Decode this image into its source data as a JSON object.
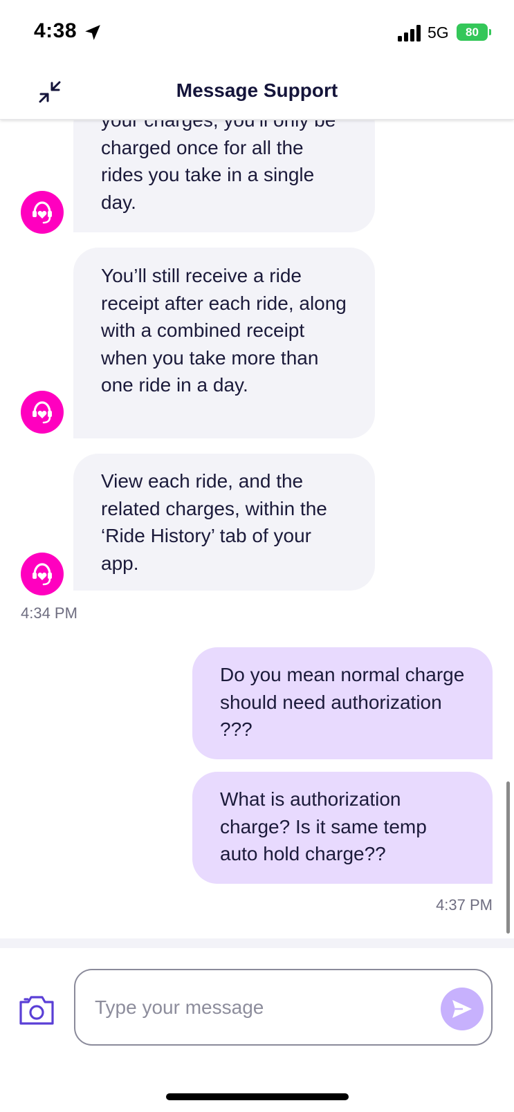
{
  "status_bar": {
    "time": "4:38",
    "network": "5G",
    "battery": "80"
  },
  "header": {
    "title": "Message Support"
  },
  "messages": [
    {
      "sender": "support",
      "text": "your charges, you’ll only be charged once for all the rides you take in a single day."
    },
    {
      "sender": "support",
      "text": "You’ll still receive a ride receipt after each ride, along with a combined receipt when you take more than one ride in a day."
    },
    {
      "sender": "support",
      "text": "View each ride, and the related charges, within the ‘Ride History’ tab of your app."
    },
    {
      "sender": "user",
      "text": "Do you mean normal charge should need authorization ???"
    },
    {
      "sender": "user",
      "text": "What is authorization charge? Is it same temp auto hold charge??"
    }
  ],
  "timestamps": {
    "support": "4:34 PM",
    "user": "4:37 PM"
  },
  "composer": {
    "placeholder": "Type your message",
    "value": ""
  },
  "icons": {
    "minimize": "minimize-arrows-icon",
    "avatar": "support-agent-heart-icon",
    "camera": "camera-icon",
    "send": "send-arrow-icon",
    "location": "location-arrow-icon",
    "signal": "cellular-signal-icon"
  },
  "colors": {
    "brand_pink": "#ff00bf",
    "incoming_bubble": "#f3f3f8",
    "outgoing_bubble": "#e8dafe",
    "send_button": "#c7b1fd",
    "camera_accent": "#5a3fd6",
    "battery": "#34c759"
  }
}
